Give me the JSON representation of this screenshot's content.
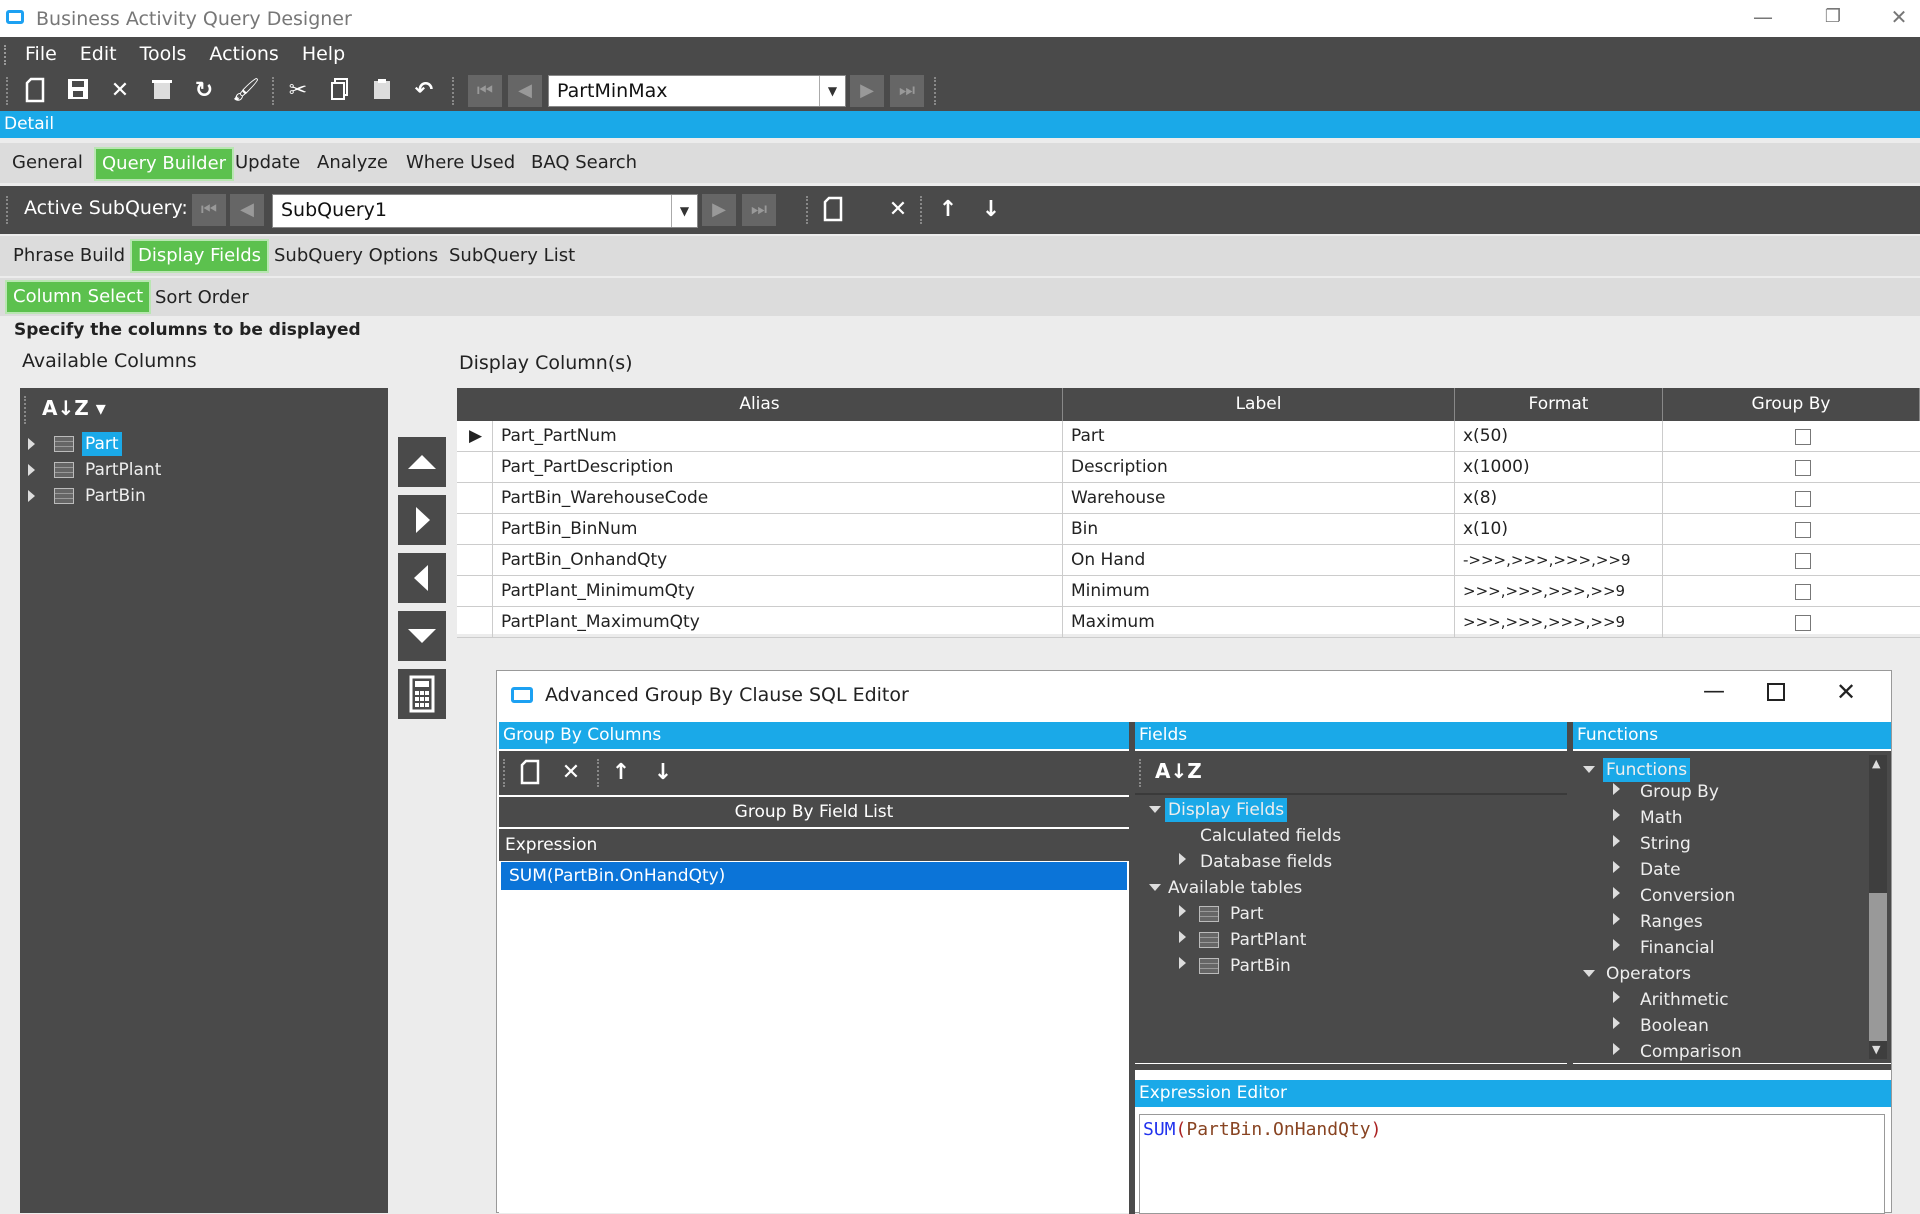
{
  "window": {
    "title": "Business Activity Query Designer",
    "minimize": "—",
    "restore": "❐",
    "close": "✕"
  },
  "menu": [
    "File",
    "Edit",
    "Tools",
    "Actions",
    "Help"
  ],
  "toolbar": {
    "query_id": "PartMinMax"
  },
  "detail_label": "Detail",
  "main_tabs": [
    "General",
    "Query Builder",
    "Update",
    "Analyze",
    "Where Used",
    "BAQ Search"
  ],
  "subquery": {
    "label": "Active SubQuery:",
    "value": "SubQuery1"
  },
  "sub_tabs": [
    "Phrase Build",
    "Display Fields",
    "SubQuery Options",
    "SubQuery List"
  ],
  "column_tabs": [
    "Column Select",
    "Sort Order"
  ],
  "instructions": "Specify the columns to be displayed",
  "available_columns": {
    "label": "Available Columns",
    "tables": [
      "Part",
      "PartPlant",
      "PartBin"
    ]
  },
  "display_columns": {
    "label": "Display Column(s)",
    "headers": [
      "Alias",
      "Label",
      "Format",
      "Group By"
    ],
    "rows": [
      {
        "alias": "Part_PartNum",
        "label": "Part",
        "format": "x(50)"
      },
      {
        "alias": "Part_PartDescription",
        "label": "Description",
        "format": "x(1000)"
      },
      {
        "alias": "PartBin_WarehouseCode",
        "label": "Warehouse",
        "format": "x(8)"
      },
      {
        "alias": "PartBin_BinNum",
        "label": "Bin",
        "format": "x(10)"
      },
      {
        "alias": "PartBin_OnhandQty",
        "label": "On Hand",
        "format": "->>>,>>>,>>>,>>9"
      },
      {
        "alias": "PartPlant_MinimumQty",
        "label": "Minimum",
        "format": ">>>,>>>,>>>,>>9"
      },
      {
        "alias": "PartPlant_MaximumQty",
        "label": "Maximum",
        "format": ">>>,>>>,>>>,>>9"
      }
    ]
  },
  "dialog": {
    "title": "Advanced Group By Clause SQL Editor",
    "group_by": {
      "header": "Group By Columns",
      "list_title": "Group By Field List",
      "col_header": "Expression",
      "items": [
        "SUM(PartBin.OnHandQty)"
      ]
    },
    "fields": {
      "header": "Fields",
      "display_fields": "Display Fields",
      "calculated": "Calculated fields",
      "database": "Database fields",
      "available_tables": "Available tables",
      "tables": [
        "Part",
        "PartPlant",
        "PartBin"
      ]
    },
    "functions": {
      "header": "Functions",
      "root": "Functions",
      "items": [
        "Group By",
        "Math",
        "String",
        "Date",
        "Conversion",
        "Ranges",
        "Financial"
      ],
      "operators": "Operators",
      "operator_items": [
        "Arithmetic",
        "Boolean",
        "Comparison"
      ]
    },
    "expression_editor": {
      "header": "Expression Editor",
      "fn": "SUM",
      "open": "(",
      "arg": "PartBin.OnHandQty",
      "close": ")"
    }
  },
  "colors": {
    "accent": "#1aa9e8",
    "tab_active": "#5cc14e",
    "toolbar": "#4a4a4a"
  }
}
